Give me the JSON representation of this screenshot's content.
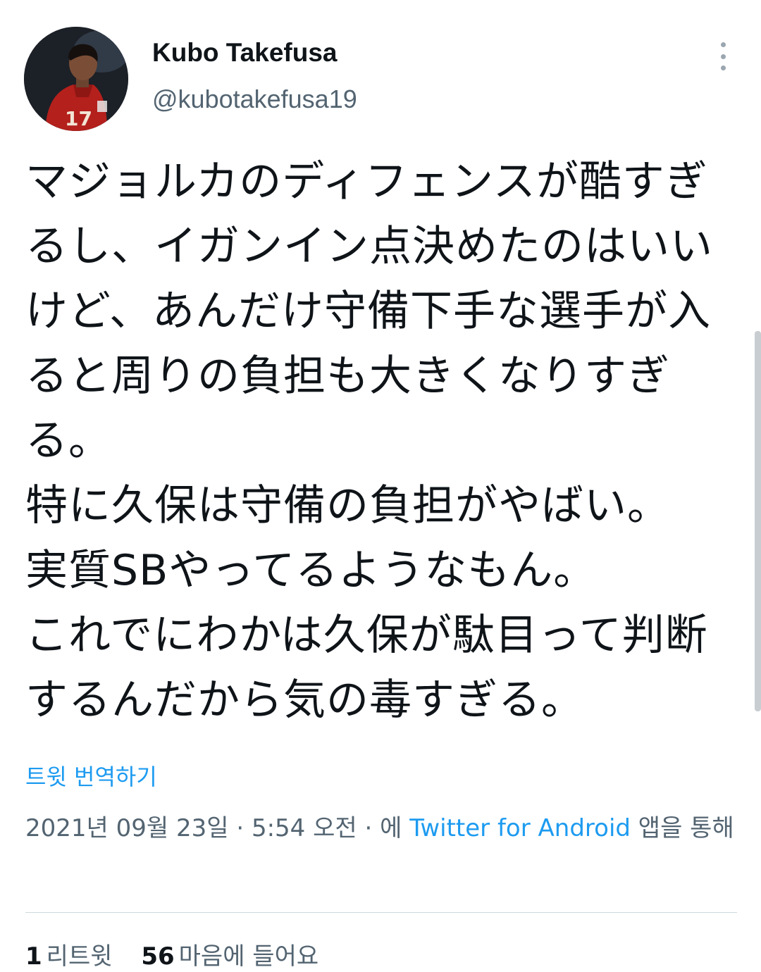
{
  "author": {
    "display_name": "Kubo Takefusa",
    "handle": "@kubotakefusa19",
    "avatar_icon": "player-avatar-photo"
  },
  "more_icon": "more-vertical-icon",
  "tweet": {
    "lines": [
      "マジョルカのディフェンスが酷すぎ",
      "るし、イガンイン点決めたのはいい",
      "けど、あんだけ守備下手な選手が入",
      "ると周りの負担も大きくなりすぎ",
      "る。",
      "特に久保は守備の負担がやばい。",
      "実質SBやってるようなもん。",
      "これでにわかは久保が駄目って判断",
      "するんだから気の毒すぎる。"
    ]
  },
  "translate_label": "트윗 번역하기",
  "meta": {
    "date": "2021년 09월 23일",
    "separator": "·",
    "time": "5:54 오전",
    "via_prefix": "· 에",
    "source": "Twitter for Android",
    "via_suffix": "앱을 통해"
  },
  "stats": {
    "retweets_count": "1",
    "retweets_label": "리트윗",
    "likes_count": "56",
    "likes_label": "마음에 들어요"
  },
  "colors": {
    "link": "#1d9bf0",
    "secondary_text": "#536471",
    "primary_text": "#0f1419"
  }
}
